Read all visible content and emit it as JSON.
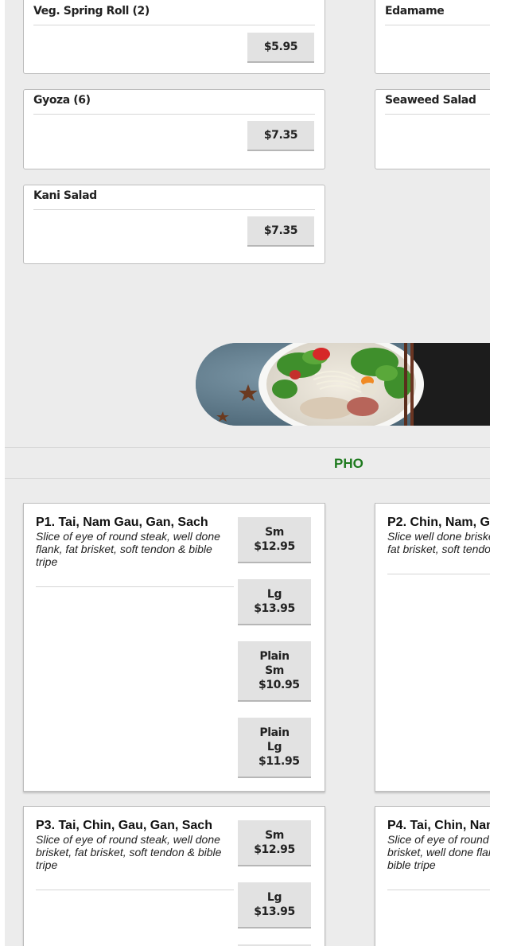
{
  "appetizers": [
    {
      "name": "Veg. Spring Roll (2)",
      "price": "$5.95"
    },
    {
      "name": "Edamame"
    },
    {
      "name": "Gyoza (6)",
      "price": "$7.35"
    },
    {
      "name": "Seaweed Salad"
    },
    {
      "name": "Kani Salad",
      "price": "$7.35"
    }
  ],
  "banner": {
    "image": "pho-bowl-photo"
  },
  "section": {
    "title": "PHO"
  },
  "pho": [
    {
      "title": "P1. Tai, Nam Gau, Gan, Sach",
      "desc": "Slice of eye of round steak, well done flank, fat brisket, soft tendon & bible tripe",
      "prices": [
        {
          "label": "Sm",
          "price": "$12.95"
        },
        {
          "label": "Lg",
          "price": "$13.95"
        },
        {
          "label": "Plain Sm",
          "price": "$10.95"
        },
        {
          "label": "Plain Lg",
          "price": "$11.95"
        }
      ]
    },
    {
      "title": "P2. Chin, Nam, G",
      "desc": "Slice well done briske fat brisket, soft tendo"
    },
    {
      "title": "P3. Tai, Chin, Gau, Gan, Sach",
      "desc": "Slice of eye of round steak, well done brisket, fat brisket, soft tendon & bible tripe",
      "prices": [
        {
          "label": "Sm",
          "price": "$12.95"
        },
        {
          "label": "Lg",
          "price": "$13.95"
        }
      ]
    },
    {
      "title": "P4. Tai, Chin, Nam",
      "desc": "Slice of eye of round brisket, well done flan bible tripe"
    }
  ],
  "colors": {
    "section_title": "#1e7a1e",
    "page_bg": "#ececec",
    "button_bg": "#e2e2e2"
  }
}
